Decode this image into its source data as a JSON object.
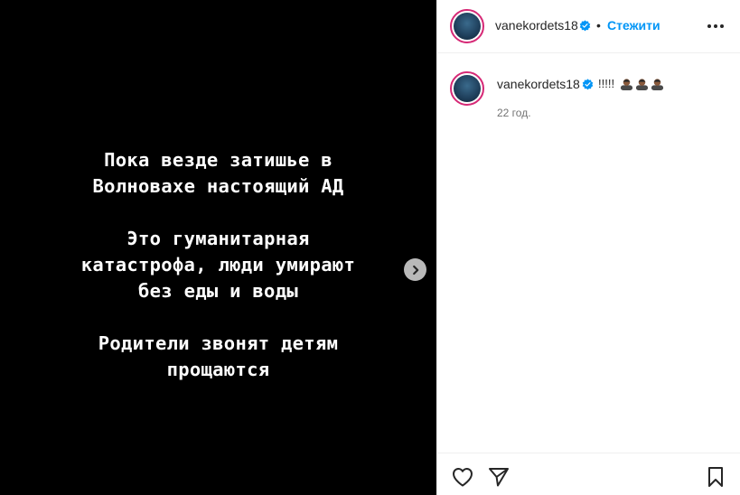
{
  "media": {
    "paragraphs": [
      "Пока везде затишье в\nВолновахе настоящий АД",
      "Это гуманитарная\nкатастрофа, люди умирают\nбез еды и воды",
      "Родители звонят детям\nпрощаются"
    ],
    "next_icon": "chevron-right-icon"
  },
  "header": {
    "username": "vanekordets18",
    "verified": true,
    "separator": "•",
    "follow_label": "Стежити",
    "more_icon": "more-horizontal-icon"
  },
  "caption": {
    "username": "vanekordets18",
    "verified": true,
    "text": "!!!!!",
    "emojis": [
      "person-emoji",
      "person-emoji",
      "person-emoji"
    ],
    "time": "22 год."
  },
  "actions": {
    "like_icon": "heart-icon",
    "share_icon": "send-icon",
    "save_icon": "bookmark-icon"
  },
  "colors": {
    "media_bg": "#000000",
    "accent": "#0095f6",
    "verified": "#0095f6",
    "text": "#262626",
    "muted": "#737373"
  }
}
